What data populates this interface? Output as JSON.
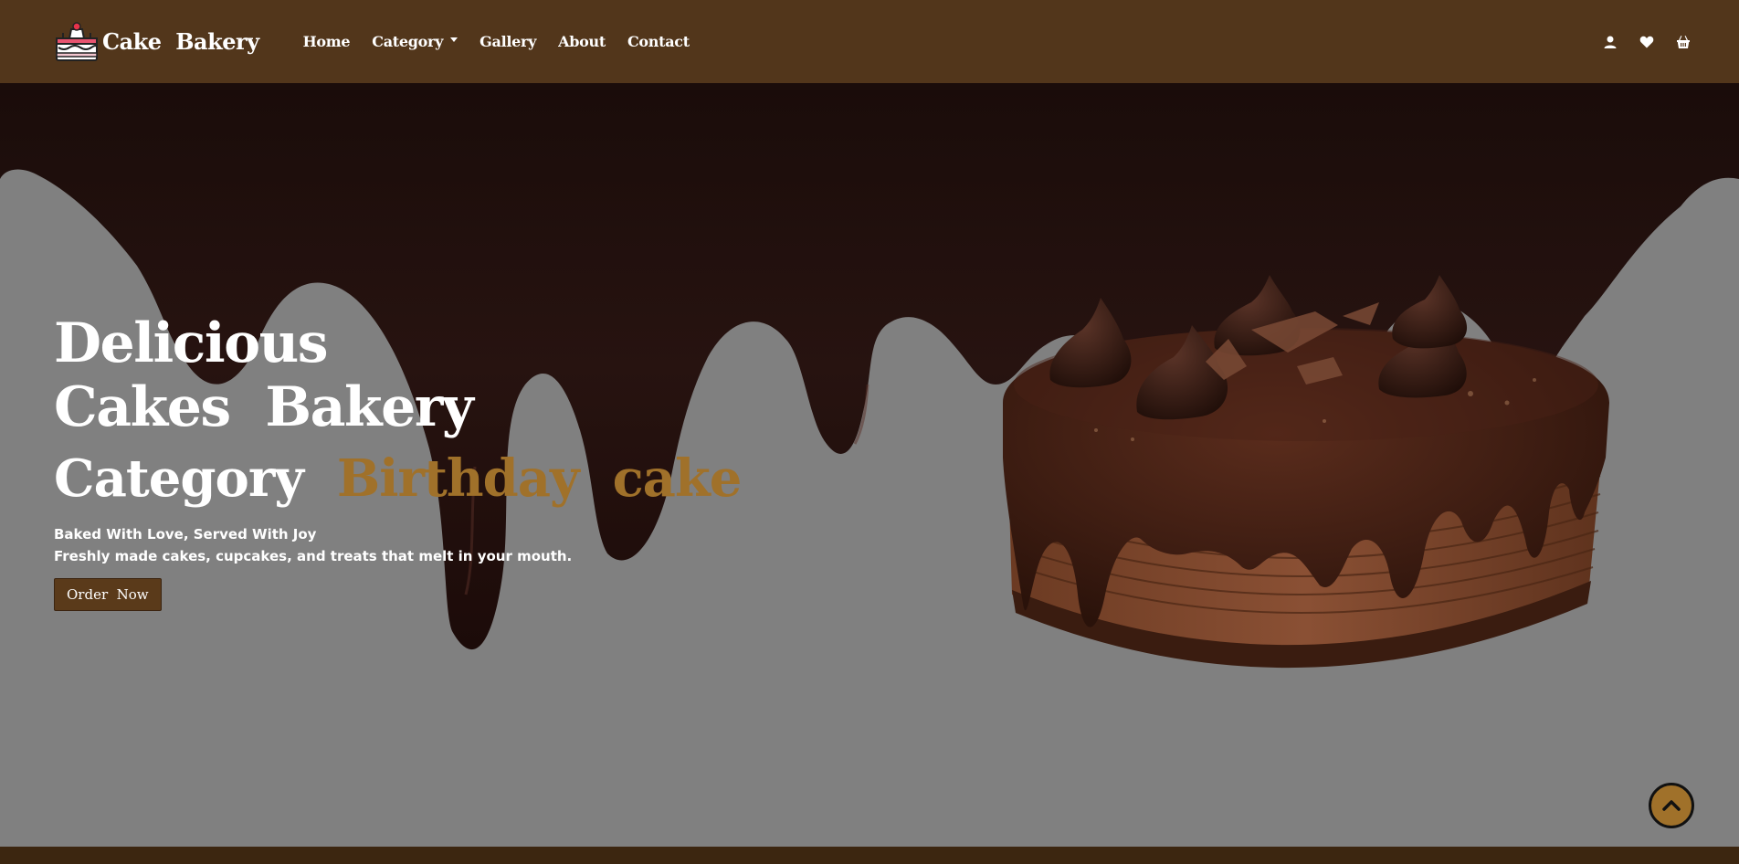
{
  "brand": {
    "name": "Cake  Bakery",
    "logo_icon": "cake-logo-icon"
  },
  "nav": {
    "links": [
      {
        "label": "Home"
      },
      {
        "label": "Category"
      },
      {
        "label": "Gallery"
      },
      {
        "label": "About"
      },
      {
        "label": "Contact"
      }
    ],
    "icons": [
      "user-icon",
      "heart-icon",
      "basket-icon"
    ]
  },
  "hero": {
    "title_line1": "Delicious",
    "title_line2": "Cakes  Bakery",
    "category_prefix": "Category  ",
    "category_highlight": "Birthday  cake",
    "tagline_1": "Baked With Love, Served With Joy",
    "tagline_2": "Freshly made cakes, cupcakes, and treats that melt in your mouth.",
    "cta_label": "Order  Now"
  },
  "colors": {
    "navbar": "#52361b",
    "hero_bg": "#808080",
    "chocolate": "#24100d",
    "accent": "#a0712a"
  },
  "back_to_top_icon": "chevron-up-icon"
}
